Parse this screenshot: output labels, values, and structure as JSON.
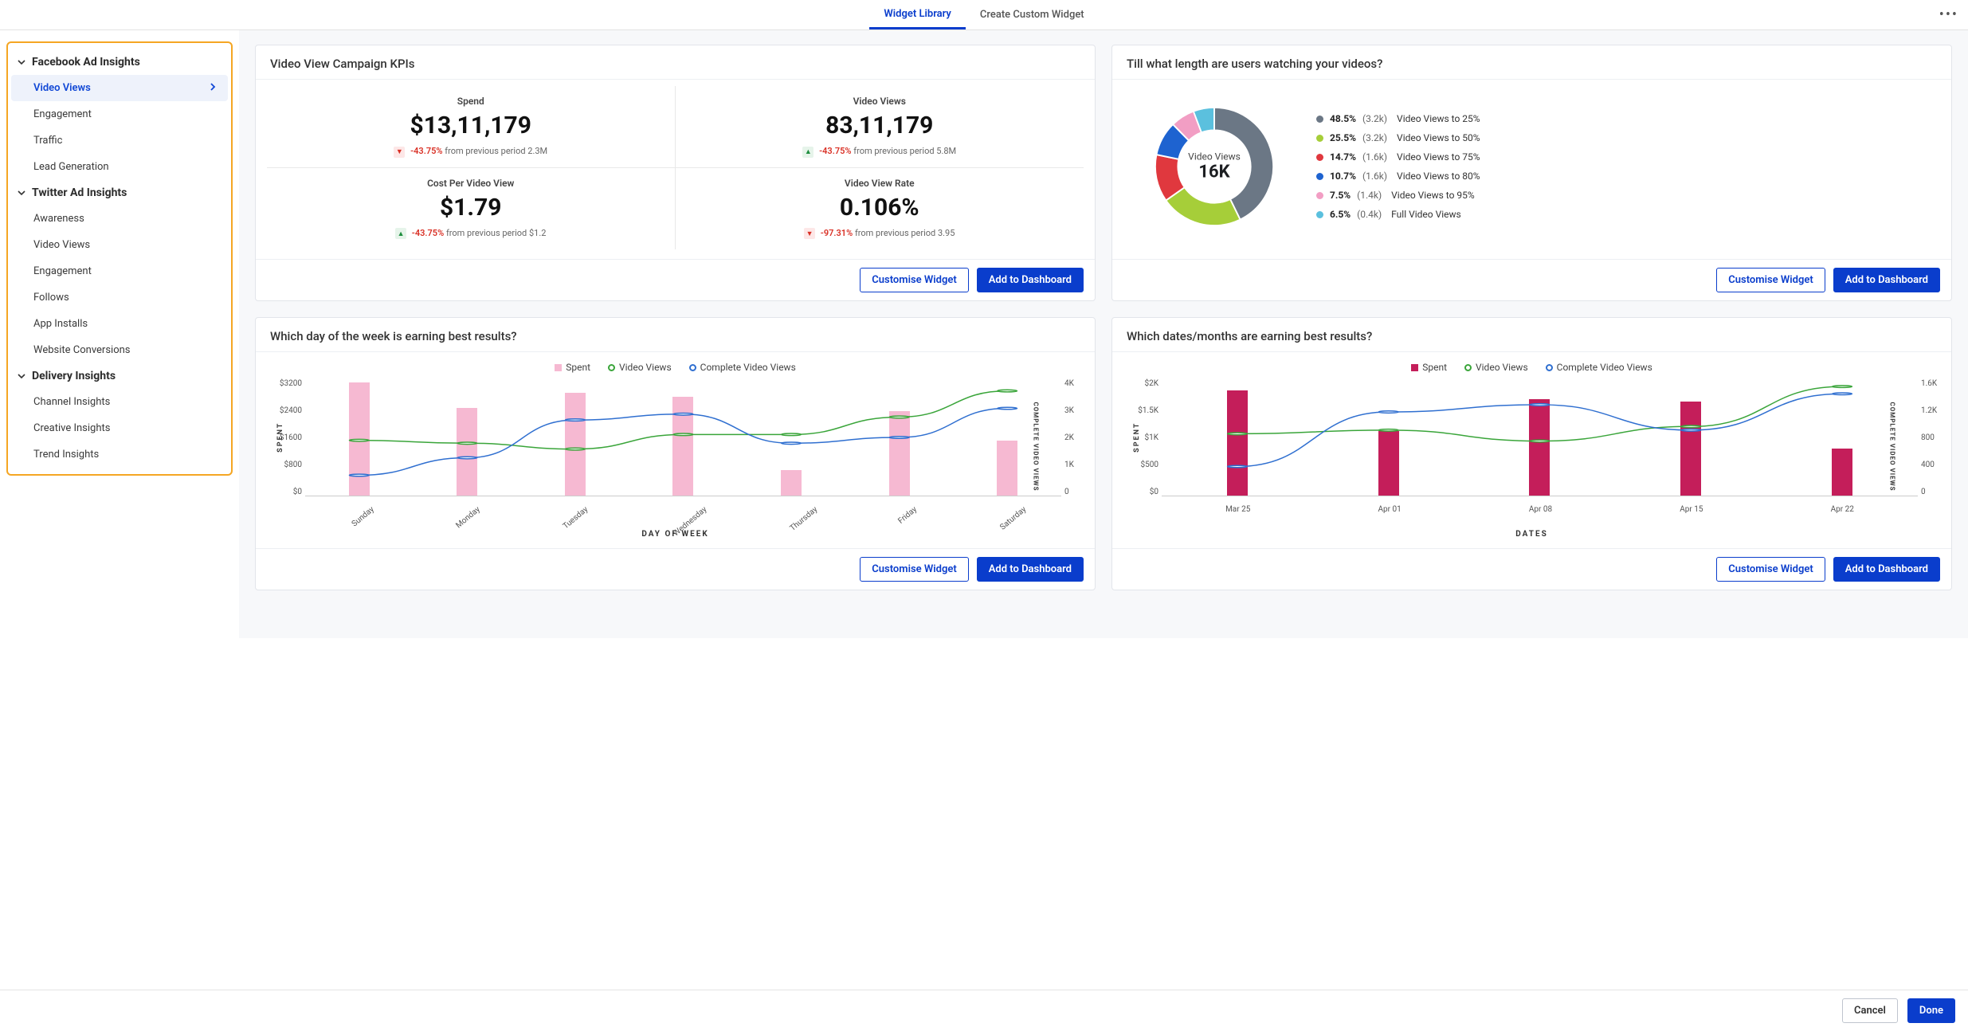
{
  "colors": {
    "blue": "#0a3dcc",
    "pink": "#f29ec4",
    "pinkLight": "#f6b9d2",
    "crimson": "#c41e5a",
    "green": "#3aa53a",
    "lineBlue": "#2f6fd0",
    "donut": [
      "#6b7785",
      "#a6ce39",
      "#e0383e",
      "#1e63d0",
      "#f29ec4",
      "#5bc0de"
    ]
  },
  "topTabs": {
    "active": "Widget Library",
    "other": "Create Custom Widget"
  },
  "sidebar": {
    "groups": [
      {
        "title": "Facebook Ad Insights",
        "items": [
          "Video Views",
          "Engagement",
          "Traffic",
          "Lead Generation"
        ],
        "activeIndex": 0
      },
      {
        "title": "Twitter Ad Insights",
        "items": [
          "Awareness",
          "Video Views",
          "Engagement",
          "Follows",
          "App Installs",
          "Website Conversions"
        ]
      },
      {
        "title": "Delivery Insights",
        "items": [
          "Channel Insights",
          "Creative Insights",
          "Trend Insights"
        ]
      }
    ]
  },
  "buttons": {
    "customise": "Customise Widget",
    "add": "Add to Dashboard",
    "cancel": "Cancel",
    "done": "Done"
  },
  "card_kpi": {
    "title": "Video View Campaign KPIs",
    "cells": [
      {
        "label": "Spend",
        "value": "$13,11,179",
        "dir": "down",
        "pct": "-43.75%",
        "note": "from previous period 2.3M"
      },
      {
        "label": "Video Views",
        "value": "83,11,179",
        "dir": "up",
        "pct": "-43.75%",
        "note": "from previous period 5.8M"
      },
      {
        "label": "Cost Per Video View",
        "value": "$1.79",
        "dir": "up",
        "pct": "-43.75%",
        "note": "from previous period $1.2"
      },
      {
        "label": "Video View Rate",
        "value": "0.106%",
        "dir": "down",
        "pct": "-97.31%",
        "note": "from previous period 3.95"
      }
    ]
  },
  "card_donut": {
    "title": "Till what length are users watching your videos?",
    "center_label": "Video Views",
    "center_value": "16K",
    "slices": [
      {
        "pct": "48.5%",
        "count": "(3.2k)",
        "desc": "Video Views to 25%"
      },
      {
        "pct": "25.5%",
        "count": "(3.2k)",
        "desc": "Video Views to 50%"
      },
      {
        "pct": "14.7%",
        "count": "(1.6k)",
        "desc": "Video Views to 75%"
      },
      {
        "pct": "10.7%",
        "count": "(1.6k)",
        "desc": "Video Views to 80%"
      },
      {
        "pct": "7.5%",
        "count": "(1.4k)",
        "desc": "Video Views to 95%"
      },
      {
        "pct": "6.5%",
        "count": "(0.4k)",
        "desc": "Full Video Views"
      }
    ]
  },
  "card_dow": {
    "title": "Which day of the week is earning best results?",
    "legend": {
      "spent": "Spent",
      "vv": "Video Views",
      "cvv": "Complete Video Views"
    },
    "y_left_label": "SPENT",
    "y_right_label": "COMPLETE VIDEO VIEWS",
    "x_label": "DAY OF WEEK"
  },
  "card_dates": {
    "title": "Which dates/months are earning best results?",
    "legend": {
      "spent": "Spent",
      "vv": "Video Views",
      "cvv": "Complete Video Views"
    },
    "y_left_label": "SPENT",
    "y_right_label": "COMPLETE VIDEO VIEWS",
    "x_label": "DATES"
  },
  "chart_data": [
    {
      "id": "dow_chart",
      "type": "bar+line",
      "xlabel": "DAY OF WEEK",
      "ylabel": "SPENT",
      "y2label": "COMPLETE VIDEO VIEWS",
      "categories": [
        "Sunday",
        "Monday",
        "Tuesday",
        "Wednesday",
        "Thursday",
        "Friday",
        "Saturday"
      ],
      "y_left_ticks": [
        "$3200",
        "$2400",
        "$1600",
        "$800",
        "$0"
      ],
      "ylim_left": [
        0,
        3200
      ],
      "y_right_ticks": [
        "4K",
        "3K",
        "2K",
        "1K",
        "0"
      ],
      "ylim_right": [
        0,
        4000
      ],
      "series": [
        {
          "name": "Spent",
          "type": "bar",
          "axis": "left",
          "values": [
            3100,
            2400,
            2800,
            2700,
            700,
            2300,
            1500
          ]
        },
        {
          "name": "Video Views",
          "type": "line",
          "axis": "right",
          "values": [
            1900,
            1800,
            1600,
            2100,
            2100,
            2700,
            3600
          ]
        },
        {
          "name": "Complete Video Views",
          "type": "line",
          "axis": "right",
          "values": [
            700,
            1300,
            2600,
            2800,
            1800,
            2000,
            3000
          ]
        }
      ]
    },
    {
      "id": "dates_chart",
      "type": "bar+line",
      "xlabel": "DATES",
      "ylabel": "SPENT",
      "y2label": "COMPLETE VIDEO VIEWS",
      "categories": [
        "Mar 25",
        "Apr 01",
        "Apr 08",
        "Apr 15",
        "Apr 22"
      ],
      "y_left_ticks": [
        "$2K",
        "$1.5K",
        "$1K",
        "$500",
        "$0"
      ],
      "ylim_left": [
        0,
        2000
      ],
      "y_right_ticks": [
        "1.6K",
        "1.2K",
        "800",
        "400",
        "0"
      ],
      "ylim_right": [
        0,
        1600
      ],
      "series": [
        {
          "name": "Spent",
          "type": "bar",
          "axis": "left",
          "values": [
            1800,
            1100,
            1650,
            1600,
            800
          ]
        },
        {
          "name": "Video Views",
          "type": "line",
          "axis": "right",
          "values": [
            850,
            900,
            750,
            950,
            1500
          ]
        },
        {
          "name": "Complete Video Views",
          "type": "line",
          "axis": "right",
          "values": [
            400,
            1150,
            1250,
            900,
            1400
          ]
        }
      ]
    },
    {
      "id": "donut_chart",
      "type": "pie",
      "title": "Video Views 16K",
      "slices": [
        {
          "label": "Video Views to 25%",
          "value": 48.5
        },
        {
          "label": "Video Views to 50%",
          "value": 25.5
        },
        {
          "label": "Video Views to 75%",
          "value": 14.7
        },
        {
          "label": "Video Views to 80%",
          "value": 10.7
        },
        {
          "label": "Video Views to 95%",
          "value": 7.5
        },
        {
          "label": "Full Video Views",
          "value": 6.5
        }
      ]
    }
  ]
}
